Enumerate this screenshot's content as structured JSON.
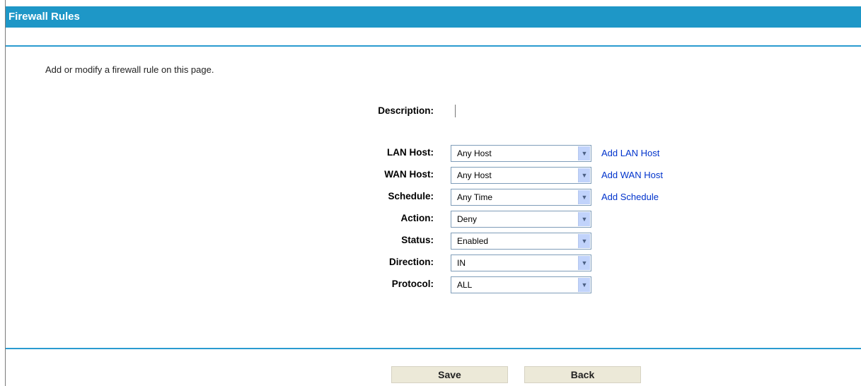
{
  "header": {
    "title": "Firewall Rules"
  },
  "intro": "Add or modify a firewall rule on this page.",
  "form": {
    "description_label": "Description:",
    "description_value": "",
    "lan_host": {
      "label": "LAN Host:",
      "value": "Any Host",
      "link": "Add LAN Host"
    },
    "wan_host": {
      "label": "WAN Host:",
      "value": "Any Host",
      "link": "Add WAN Host"
    },
    "schedule": {
      "label": "Schedule:",
      "value": "Any Time",
      "link": "Add Schedule"
    },
    "action": {
      "label": "Action:",
      "value": "Deny"
    },
    "status": {
      "label": "Status:",
      "value": "Enabled"
    },
    "direction": {
      "label": "Direction:",
      "value": "IN"
    },
    "protocol": {
      "label": "Protocol:",
      "value": "ALL"
    }
  },
  "buttons": {
    "save": "Save",
    "back": "Back"
  },
  "colors": {
    "header_bg": "#1e97c7",
    "rule": "#2a9bd0",
    "link": "#0033cc",
    "button_bg": "#ece9d8"
  }
}
